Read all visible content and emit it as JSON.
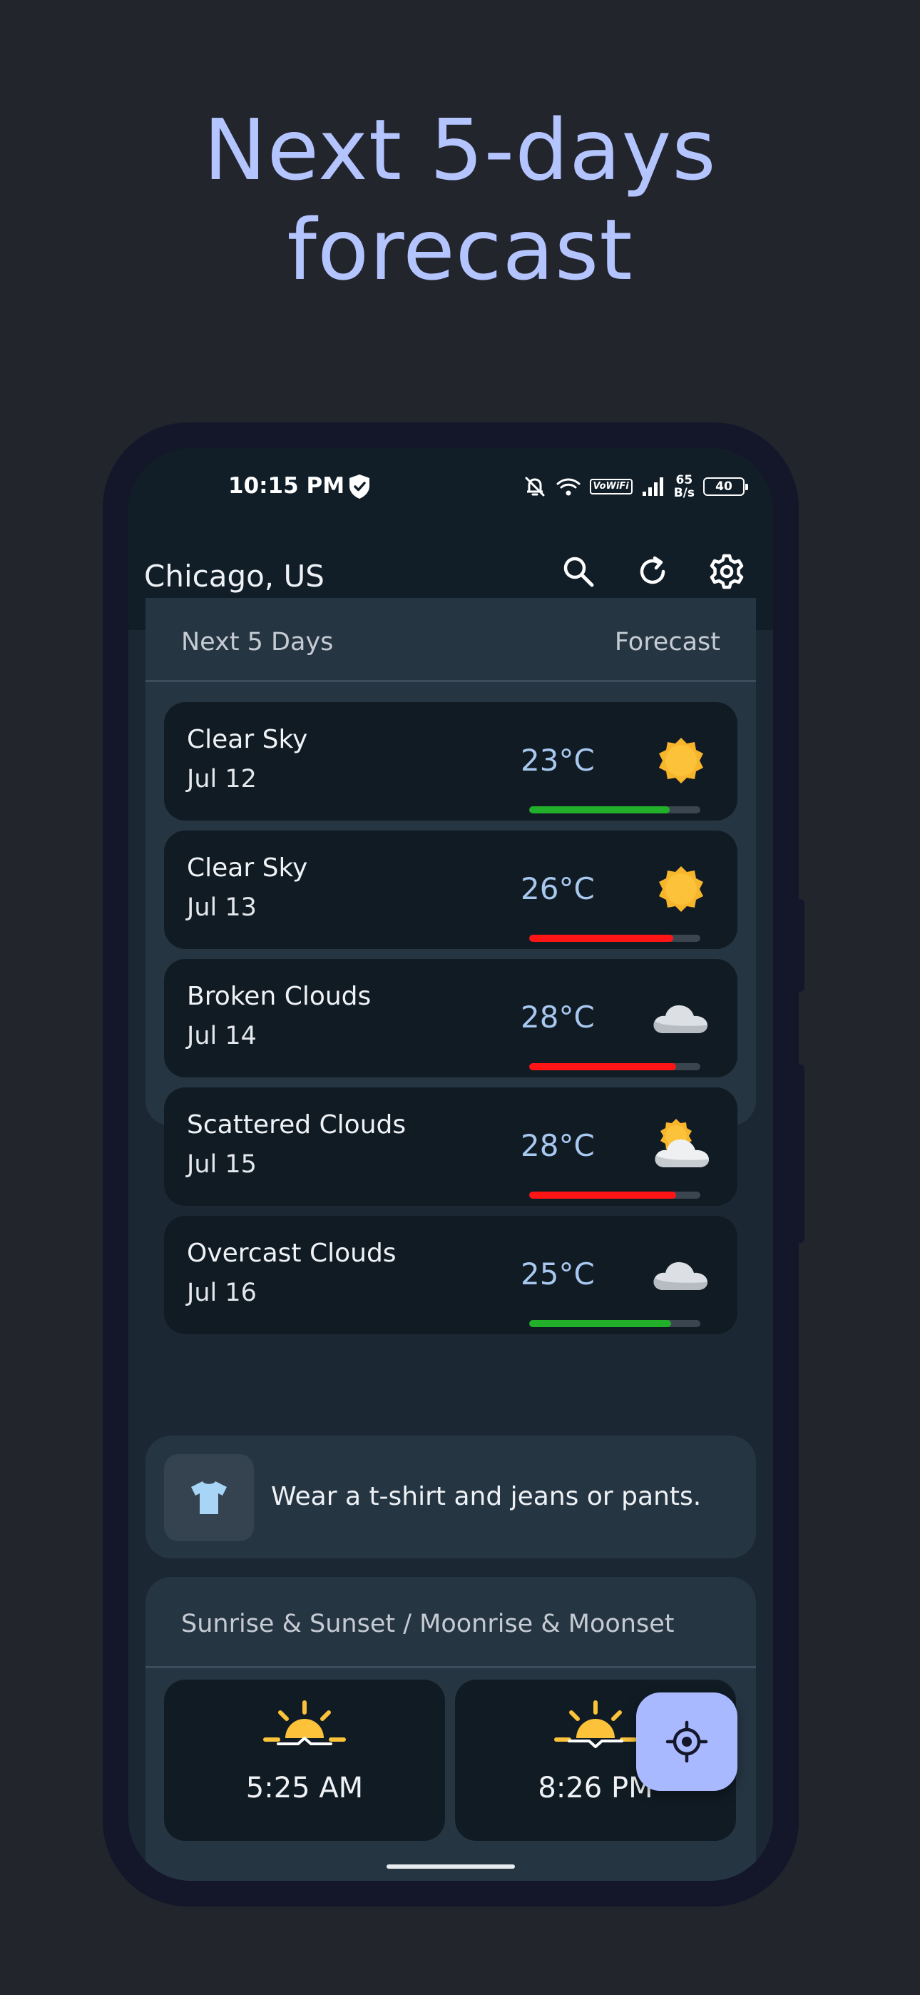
{
  "promo": {
    "line1": "Next 5-days",
    "line2": "forecast"
  },
  "status_bar": {
    "time": "10:15 PM",
    "net_speed_value": "65",
    "net_speed_unit": "B/s",
    "volte": "VoWiFi",
    "battery": "40"
  },
  "header": {
    "city": "Chicago, US",
    "actions": [
      "search-icon",
      "refresh-icon",
      "settings-icon"
    ]
  },
  "forecast": {
    "title_left": "Next 5 Days",
    "title_right": "Forecast",
    "days": [
      {
        "condition": "Clear Sky",
        "date": "Jul 12",
        "temp": "23°C",
        "icon": "sun-icon",
        "bar_percent": 82,
        "bar_color": "#22b02a"
      },
      {
        "condition": "Clear Sky",
        "date": "Jul 13",
        "temp": "26°C",
        "icon": "sun-icon",
        "bar_percent": 84,
        "bar_color": "#ff1515"
      },
      {
        "condition": "Broken Clouds",
        "date": "Jul 14",
        "temp": "28°C",
        "icon": "cloud-icon",
        "bar_percent": 86,
        "bar_color": "#ff1515"
      },
      {
        "condition": "Scattered Clouds",
        "date": "Jul 15",
        "temp": "28°C",
        "icon": "sun-cloud-icon",
        "bar_percent": 86,
        "bar_color": "#ff1515"
      },
      {
        "condition": "Overcast Clouds",
        "date": "Jul 16",
        "temp": "25°C",
        "icon": "cloud-icon",
        "bar_percent": 83,
        "bar_color": "#22b02a"
      }
    ]
  },
  "clothing_tip": {
    "icon": "tshirt-icon",
    "text": "Wear a t-shirt and jeans or pants."
  },
  "sun_moon": {
    "title": "Sunrise & Sunset / Moonrise & Moonset",
    "sunrise": {
      "icon": "sunrise-icon",
      "time": "5:25 AM"
    },
    "sunset": {
      "icon": "sunset-icon",
      "time": "8:26 PM"
    }
  },
  "fab": {
    "icon": "my-location-icon"
  },
  "colors": {
    "accent": "#b4c4ff",
    "background": "#22252c",
    "card": "#263542",
    "row": "#101b24"
  }
}
